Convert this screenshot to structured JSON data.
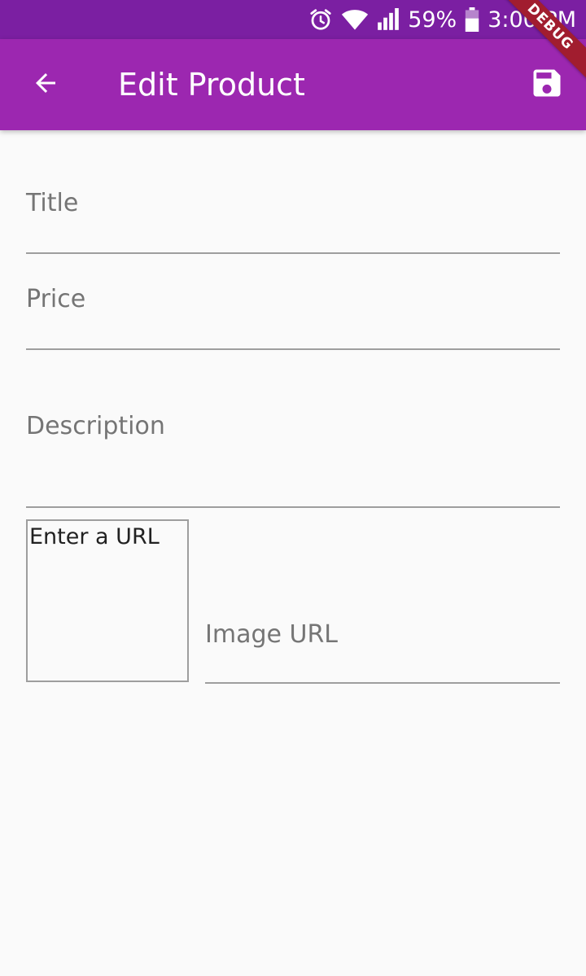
{
  "status_bar": {
    "battery": "59%",
    "time": "3:00 PM",
    "icons": [
      "alarm-icon",
      "wifi-icon",
      "signal-icon",
      "battery-icon"
    ]
  },
  "app_bar": {
    "title": "Edit Product",
    "back_icon": "arrow-back-icon",
    "save_icon": "save-icon",
    "color": "#9c27b0",
    "status_color": "#7b1fa2"
  },
  "debug_banner": "DEBUG",
  "form": {
    "title_label": "Title",
    "price_label": "Price",
    "description_label": "Description",
    "image_url_label": "Image URL",
    "image_preview_placeholder": "Enter a URL"
  }
}
